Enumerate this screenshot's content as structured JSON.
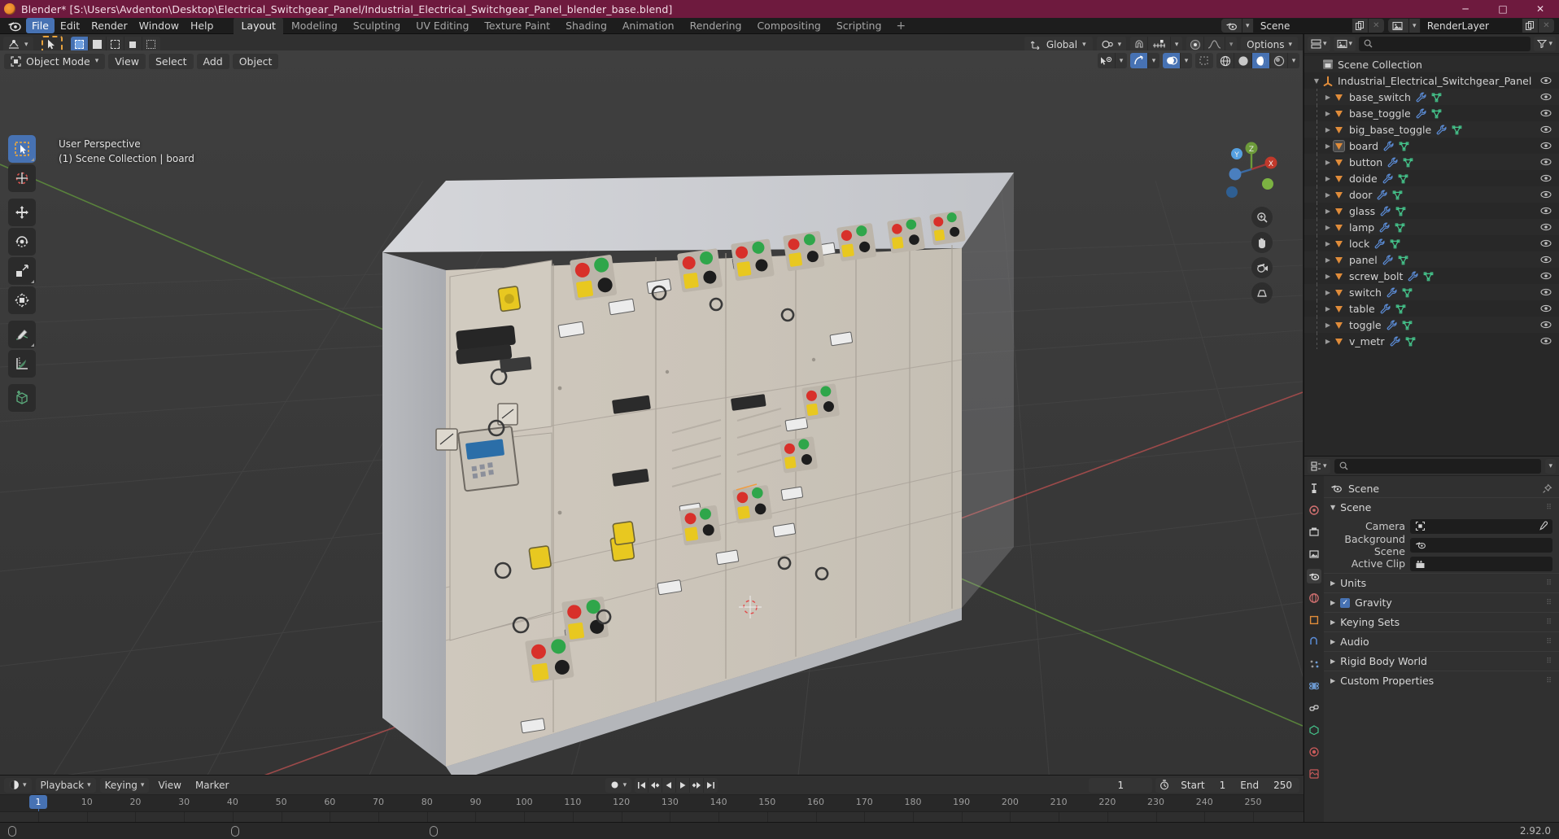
{
  "window": {
    "title": "Blender* [S:\\Users\\Avdenton\\Desktop\\Electrical_Switchgear_Panel/Industrial_Electrical_Switchgear_Panel_blender_base.blend]",
    "minimize": "─",
    "maximize": "□",
    "close": "✕"
  },
  "topbar": {
    "menus": [
      "File",
      "Edit",
      "Render",
      "Window",
      "Help"
    ],
    "active_menu": "File",
    "workspaces": [
      "Layout",
      "Modeling",
      "Sculpting",
      "UV Editing",
      "Texture Paint",
      "Shading",
      "Animation",
      "Rendering",
      "Compositing",
      "Scripting"
    ],
    "active_workspace": "Layout",
    "add_workspace": "+",
    "scene_name": "Scene",
    "view_layer_name": "RenderLayer",
    "scene_icon": "scene-icon",
    "view_layer_icon": "view-layer-icon",
    "new_icon": "new-copy-icon",
    "unlink_icon": "unlink-x-icon"
  },
  "viewport": {
    "mode": "Object Mode",
    "menus": [
      "View",
      "Select",
      "Add",
      "Object"
    ],
    "transform_orientation": "Global",
    "options_label": "Options",
    "overlay_line1": "User Perspective",
    "overlay_line2": "(1) Scene Collection | board",
    "gizmo_axes": {
      "x": "X",
      "y": "Y",
      "z": "Z"
    },
    "tools": [
      {
        "name": "tweak-select-tool",
        "selected": true
      },
      {
        "name": "cursor-tool",
        "selected": false
      },
      {
        "name": "move-tool",
        "selected": false
      },
      {
        "name": "rotate-tool",
        "selected": false
      },
      {
        "name": "scale-tool",
        "selected": false
      },
      {
        "name": "transform-tool",
        "selected": false
      },
      {
        "name": "annotate-tool",
        "selected": false
      },
      {
        "name": "measure-tool",
        "selected": false
      },
      {
        "name": "add-cube-tool",
        "selected": false
      }
    ],
    "nav_buttons": [
      "zoom-icon",
      "pan-hand-icon",
      "camera-icon",
      "ortho-persp-icon"
    ],
    "select_modes": [
      "set-select",
      "extend-select",
      "subtract-select",
      "invert-select",
      "intersect-select"
    ],
    "snap_magnet": "magnet-icon",
    "proportional_edit": "proportional-edit-icon"
  },
  "outliner": {
    "display_mode": "view-layer-icon",
    "filter_icon": "filter-icon",
    "search_placeholder": "",
    "root": "Scene Collection",
    "collection": "Industrial_Electrical_Switchgear_Panel",
    "objects": [
      {
        "name": "base_switch",
        "selected": false
      },
      {
        "name": "base_toggle",
        "selected": false
      },
      {
        "name": "big_base_toggle",
        "selected": false
      },
      {
        "name": "board",
        "selected": true
      },
      {
        "name": "button",
        "selected": false
      },
      {
        "name": "doide",
        "selected": false
      },
      {
        "name": "door",
        "selected": false
      },
      {
        "name": "glass",
        "selected": false
      },
      {
        "name": "lamp",
        "selected": false
      },
      {
        "name": "lock",
        "selected": false
      },
      {
        "name": "panel",
        "selected": false
      },
      {
        "name": "screw_bolt",
        "selected": false
      },
      {
        "name": "switch",
        "selected": false
      },
      {
        "name": "table",
        "selected": false
      },
      {
        "name": "toggle",
        "selected": false
      },
      {
        "name": "v_metr",
        "selected": false
      }
    ]
  },
  "properties": {
    "search_placeholder": "",
    "breadcrumb": "Scene",
    "panel_title": "Scene",
    "fields": [
      {
        "label": "Camera",
        "value": "",
        "icon": "camera-data-icon",
        "eyedropper": true
      },
      {
        "label": "Background Scene",
        "value": "",
        "icon": "scene-icon",
        "eyedropper": false
      },
      {
        "label": "Active Clip",
        "value": "",
        "icon": "movie-clip-icon",
        "eyedropper": false
      }
    ],
    "sections": [
      {
        "label": "Units",
        "checkbox": false
      },
      {
        "label": "Gravity",
        "checkbox": true
      },
      {
        "label": "Keying Sets",
        "checkbox": false
      },
      {
        "label": "Audio",
        "checkbox": false
      },
      {
        "label": "Rigid Body World",
        "checkbox": false
      },
      {
        "label": "Custom Properties",
        "checkbox": false
      }
    ],
    "tabs": [
      "tool-icon",
      "render-icon",
      "output-icon",
      "view-layer-icon",
      "scene-icon",
      "world-icon",
      "object-icon",
      "modifier-icon",
      "particles-icon",
      "physics-icon",
      "constraints-icon",
      "data-icon",
      "material-icon",
      "texture-icon"
    ]
  },
  "timeline": {
    "editor_icon": "timeline-icon",
    "menus": [
      "Playback",
      "Keying",
      "View",
      "Marker"
    ],
    "record_icon": "record-icon",
    "playback_buttons": [
      "jump-start-icon",
      "prev-keyframe-icon",
      "play-reverse-icon",
      "play-icon",
      "next-keyframe-icon",
      "jump-end-icon"
    ],
    "current_frame": "1",
    "start_label": "Start",
    "start_value": "1",
    "end_label": "End",
    "end_value": "250",
    "ticks": [
      "1",
      "10",
      "20",
      "30",
      "40",
      "50",
      "60",
      "70",
      "80",
      "90",
      "100",
      "110",
      "120",
      "130",
      "140",
      "150",
      "160",
      "170",
      "180",
      "190",
      "200",
      "210",
      "220",
      "230",
      "240",
      "250"
    ],
    "playhead_label": "1"
  },
  "status": {
    "version": "2.92.0",
    "hints": [
      "select-hint",
      "pan-hint",
      "menu-hint"
    ]
  },
  "colors": {
    "titlebar": "#6e1a3e",
    "accent": "#4772b3",
    "collection_orange": "#e08c3a",
    "mesh_green": "#45c58c",
    "wrench_blue": "#5b8cd6",
    "panel_bg": "#303030",
    "outliner_bg": "#282828"
  }
}
